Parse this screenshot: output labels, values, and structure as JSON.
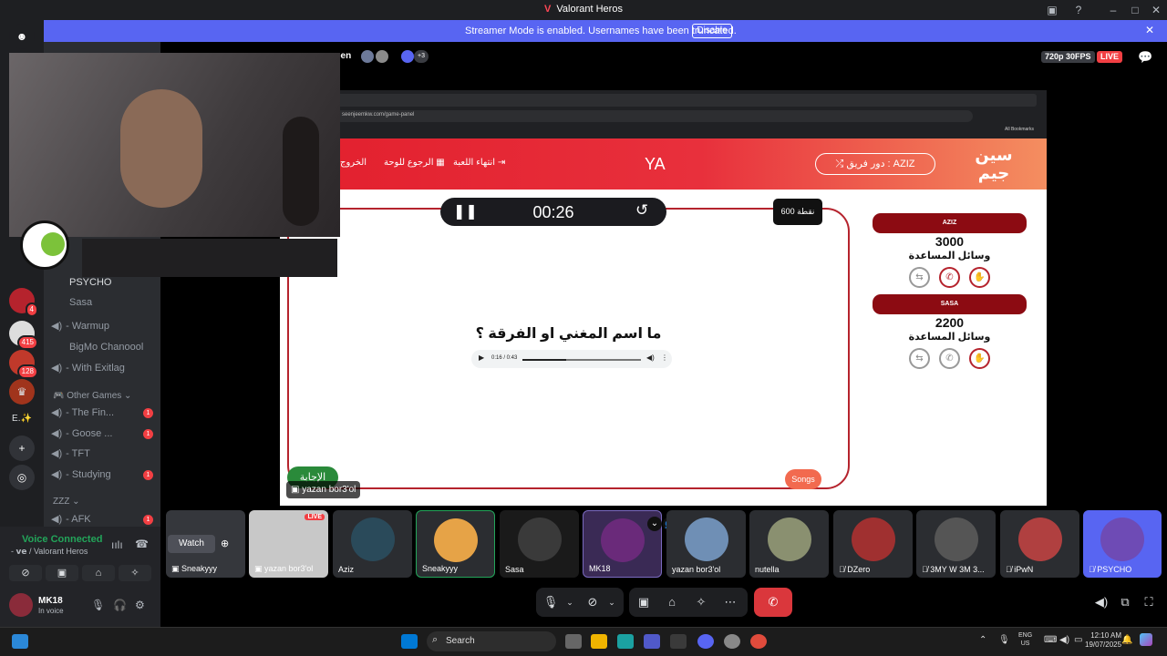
{
  "window": {
    "title": "Valorant Heros"
  },
  "banner": {
    "message": "Streamer Mode is enabled. Usernames have been truncated.",
    "disable_label": "Disable"
  },
  "servers": [
    {
      "name": "discord-home-icon"
    },
    {
      "badge": "415"
    },
    {
      "badge": "128"
    },
    {
      "label": "E.✨"
    }
  ],
  "server_badges": {
    "top": "4"
  },
  "channels": {
    "voice_users": [
      "PSYCHO",
      "Sasa"
    ],
    "items": [
      {
        "label": "- Warmup"
      },
      {
        "label": "BigMo Chanoool"
      },
      {
        "label": "- With Exitlag"
      }
    ],
    "category_other": "Other Games",
    "other_items": [
      {
        "label": "- The Fin...",
        "badge": "1"
      },
      {
        "label": "- Goose ...",
        "badge": "1"
      },
      {
        "label": "- TFT"
      },
      {
        "label": "- Studying",
        "badge": "1"
      }
    ],
    "category_zzz": "ZZZ",
    "afk": {
      "label": "- AFK",
      "badge": "1"
    }
  },
  "voice_status": {
    "title": "Voice Connected",
    "sub": "- 𝘃𝗲 / Valorant Heros"
  },
  "user": {
    "name": "MK18",
    "status": "In voice"
  },
  "stage_header": {
    "channel_fragment": "een",
    "extra_count": "+3",
    "quality": "720p 30FPS",
    "live": "LIVE"
  },
  "stream": {
    "url": "seenjeemkw.com/game-panel",
    "bookmarks": "All Bookmarks",
    "header": {
      "turn_label": "دور فريق : AZIZ",
      "center": "YA",
      "end_game": "انتهاء اللعبة",
      "back_board": "الرجوع للوحة",
      "exit": "الخروج"
    },
    "timer": "00:26",
    "points": "600 نقطة",
    "question": "ما اسم المغني او الفرقة ؟",
    "audio_time": "0:16 / 0:43",
    "audio_progress": 0.37,
    "answer_btn": "الإجابة",
    "category_btn": "Songs",
    "teams": [
      {
        "name": "AZIZ",
        "score": "3000",
        "help": "وسائل المساعدة"
      },
      {
        "name": "SASA",
        "score": "2200",
        "help": "وسائل المساعدة"
      }
    ],
    "streamer_label": "yazan bor3'ol"
  },
  "tiles": [
    {
      "name": "Sneakyyy",
      "watch": "Watch"
    },
    {
      "name": "yazan bor3'ol",
      "live": "LIVE"
    },
    {
      "name": "Aziz"
    },
    {
      "name": "Sneakyyy"
    },
    {
      "name": "Sasa"
    },
    {
      "name": "MK18"
    },
    {
      "name": "yazan bor3'ol"
    },
    {
      "name": "nutella"
    },
    {
      "name": "DZero"
    },
    {
      "name": "3MY W 3M 3..."
    },
    {
      "name": "iPwN"
    },
    {
      "name": "PSYCHO"
    }
  ],
  "taskbar": {
    "search": "Search",
    "lang": "ENG",
    "region": "US",
    "time": "12:10 AM",
    "date": "19/07/2025"
  },
  "colors": {
    "blurple": "#5865f2",
    "red": "#e21f2d",
    "live": "#f23f43",
    "green": "#23a55a"
  }
}
